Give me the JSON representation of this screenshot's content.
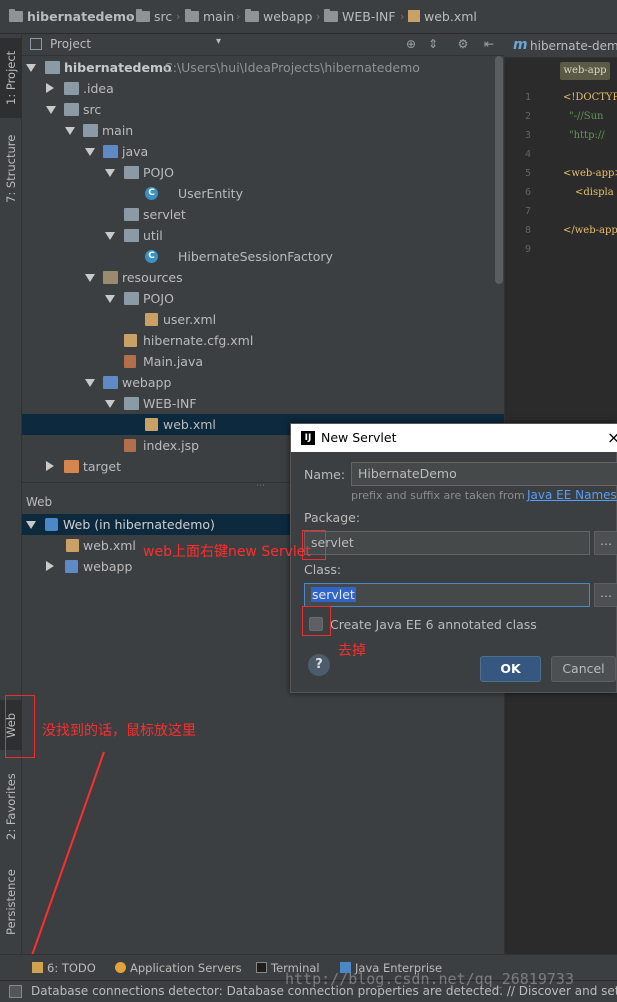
{
  "breadcrumb": {
    "items": [
      "hibernatedemo",
      "src",
      "main",
      "webapp",
      "WEB-INF",
      "web.xml"
    ]
  },
  "left_tool_windows": {
    "project": "1: Project",
    "structure": "7: Structure",
    "web": "Web",
    "favorites": "2: Favorites",
    "persistence": "Persistence"
  },
  "project_panel": {
    "title": "Project",
    "tree": [
      {
        "label": "hibernatedemo",
        "path": "C:\\Users\\hui\\IdeaProjects\\hibernatedemo"
      },
      {
        "label": ".idea"
      },
      {
        "label": "src"
      },
      {
        "label": "main"
      },
      {
        "label": "java"
      },
      {
        "label": "POJO"
      },
      {
        "label": "UserEntity"
      },
      {
        "label": "servlet"
      },
      {
        "label": "util"
      },
      {
        "label": "HibernateSessionFactory"
      },
      {
        "label": "resources"
      },
      {
        "label": "POJO"
      },
      {
        "label": "user.xml"
      },
      {
        "label": "hibernate.cfg.xml"
      },
      {
        "label": "Main.java"
      },
      {
        "label": "webapp"
      },
      {
        "label": "WEB-INF"
      },
      {
        "label": "web.xml"
      },
      {
        "label": "index.jsp"
      },
      {
        "label": "target"
      }
    ]
  },
  "web_panel": {
    "title": "Web",
    "tree": [
      {
        "label": "Web (in hibernatedemo)"
      },
      {
        "label": "web.xml"
      },
      {
        "label": "webapp"
      }
    ]
  },
  "editor": {
    "tab": "hibernate-dem",
    "tag": "web-app",
    "line_numbers": [
      "1",
      "2",
      "3",
      "4",
      "5",
      "6",
      "7",
      "8",
      "9"
    ],
    "lines": [
      "<!DOCTYPE",
      "\"-//Sun",
      "\"http://",
      "",
      "<web-app>",
      "<displa",
      "",
      "</web-app",
      ""
    ]
  },
  "dialog": {
    "title": "New Servlet",
    "close": "×",
    "name_label": "Name:",
    "name_value": "HibernateDemo",
    "hint": "prefix and suffix are taken from",
    "hint_link": "Java EE Names",
    "package_label": "Package:",
    "package_value": "servlet",
    "class_label": "Class:",
    "class_value": "servlet",
    "checkbox_label": "Create Java EE 6 annotated class",
    "help": "?",
    "ok": "OK",
    "cancel": "Cancel"
  },
  "annotations": {
    "right_click": "web上面右键new Servlet",
    "uncheck": "去掉",
    "hover_hint": "没找到的话，鼠标放这里"
  },
  "bottom_tools": {
    "todo": "6: TODO",
    "app_servers": "Application Servers",
    "terminal": "Terminal",
    "java_enterprise": "Java Enterprise"
  },
  "status": {
    "text": "Database connections detector: Database connection properties are detected. // Discover and setup",
    "watermark": "http://blog.csdn.net/qq_26819733"
  },
  "colors": {
    "background": "#3c3f41",
    "editor_bg": "#2b2b2b",
    "selection": "#0d293e",
    "accent_blue": "#4a88c7",
    "annotation_red": "#ff2d2d"
  }
}
